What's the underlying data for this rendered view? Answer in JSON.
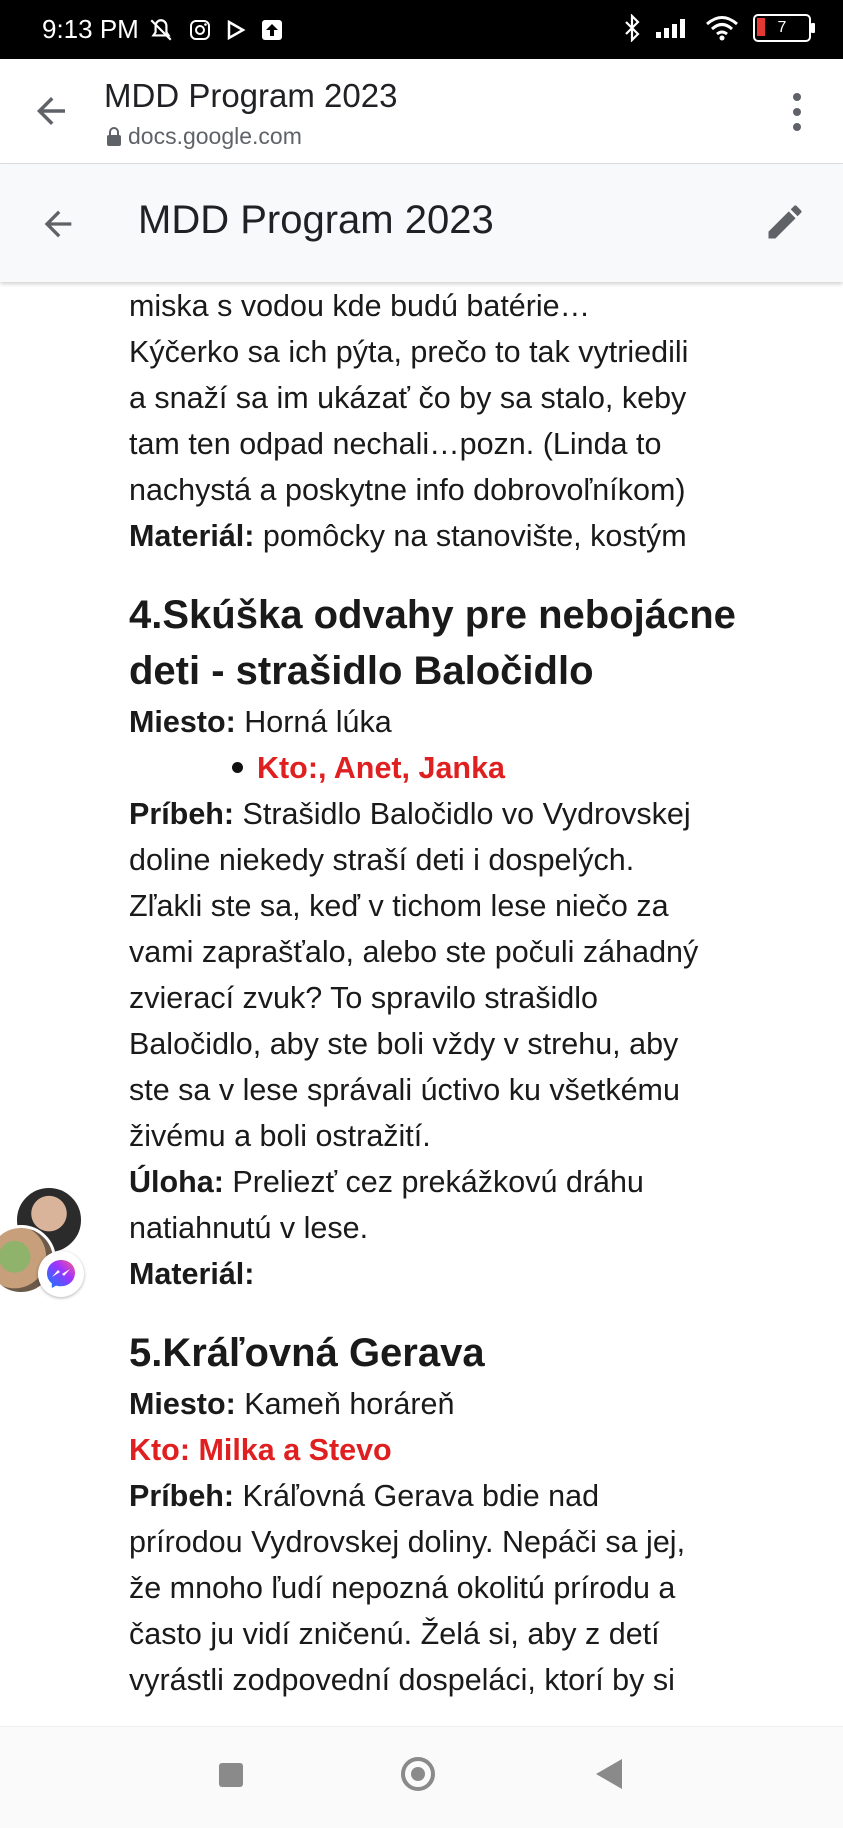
{
  "status_bar": {
    "time": "9:13 PM",
    "battery": "7",
    "left_icons": [
      "mute-bell-icon",
      "instagram-icon",
      "play-icon",
      "upload-icon"
    ],
    "right_icons": [
      "bluetooth-icon",
      "signal-icon",
      "wifi-icon",
      "battery-icon"
    ]
  },
  "browser": {
    "title": "MDD Program 2023",
    "url": "docs.google.com"
  },
  "docs_header": {
    "title": "MDD Program 2023"
  },
  "document": {
    "intro": {
      "l1": "miska s vodou kde budú batérie…",
      "l2": "Kýčerko sa ich pýta, prečo to tak vytriedili",
      "l3": "a snaží sa im ukázať čo by sa stalo, keby",
      "l4": "tam ten odpad nechali…pozn. (Linda to",
      "l5": "nachystá a poskytne info dobrovoľníkom)",
      "material_label": "Materiál:",
      "material_value": " pomôcky na stanovište, kostým"
    },
    "s4": {
      "heading_l1": "4.Skúška odvahy pre nebojácne",
      "heading_l2": "deti - strašidlo Baločidlo",
      "miesto_label": "Miesto:",
      "miesto_value": " Horná lúka",
      "kto": "Kto:, Anet, Janka",
      "pribeh_label": "Príbeh:",
      "pribeh_l1": " Strašidlo Baločidlo vo Vydrovskej",
      "pribeh_l2": "doline niekedy straší deti i dospelých.",
      "pribeh_l3": "Zľakli ste sa, keď v tichom lese niečo za",
      "pribeh_l4": "vami zaprašťalo, alebo ste počuli záhadný",
      "pribeh_l5": "zvierací zvuk? To spravilo strašidlo",
      "pribeh_l6": "Baločidlo, aby ste boli vždy v strehu, aby",
      "pribeh_l7": "ste sa v lese správali úctivo ku všetkému",
      "pribeh_l8": "živému a boli ostražití.",
      "uloha_label": "Úloha:",
      "uloha_l1": " Preliezť cez prekážkovú dráhu",
      "uloha_l2": "natiahnutú v lese.",
      "material_label": "Materiál:"
    },
    "s5": {
      "heading": "5.Kráľovná Gerava",
      "miesto_label": "Miesto:",
      "miesto_value": " Kameň horáreň",
      "kto": "Kto: Milka a Stevo",
      "pribeh_label": "Príbeh:",
      "pribeh_l1": " Kráľovná Gerava bdie nad",
      "pribeh_l2": "prírodou Vydrovskej doliny. Nepáči sa jej,",
      "pribeh_l3": "že mnoho ľudí nepozná okolitú prírodu a",
      "pribeh_l4": "často ju vidí zničenú. Želá si, aby z detí",
      "pribeh_l5": "vyrástli zodpovední dospeláci, ktorí by si"
    }
  },
  "colors": {
    "red_text": "#e02020",
    "status_bar": "#000000",
    "docs_bar": "#f8f9fa"
  }
}
